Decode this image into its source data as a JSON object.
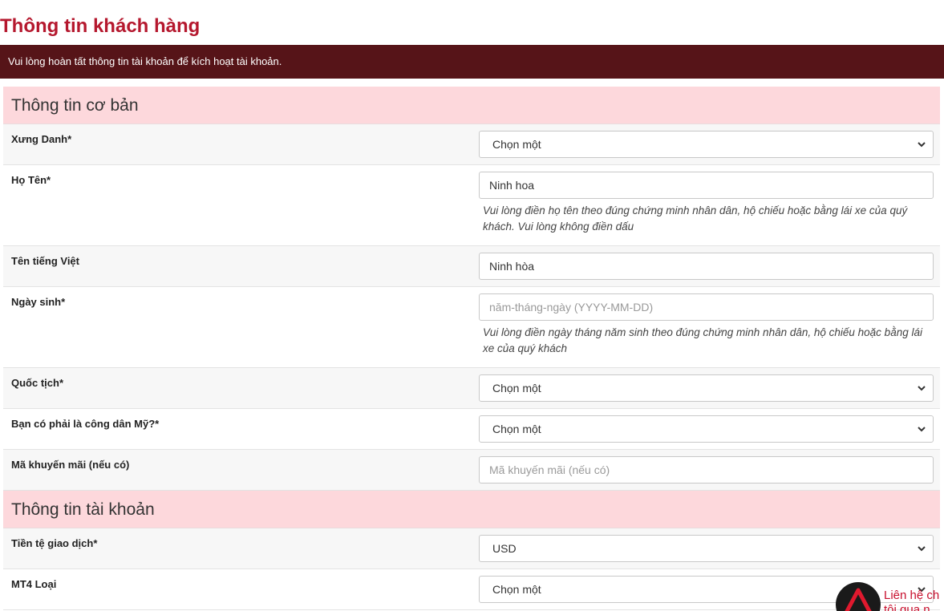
{
  "page": {
    "title": "Thông tin khách hàng",
    "notice": "Vui lòng hoàn tất thông tin tài khoản để kích hoạt tài khoản."
  },
  "sections": {
    "basic": {
      "title": "Thông tin cơ bản",
      "salutation": {
        "label": "Xưng Danh*",
        "value": "Chọn một"
      },
      "full_name": {
        "label": "Họ Tên*",
        "value": "Ninh hoa",
        "help": "Vui lòng điền họ tên theo đúng chứng minh nhân dân, hộ chiếu hoặc bằng lái xe của quý khách. Vui lòng không điền dấu"
      },
      "vietnamese_name": {
        "label": "Tên tiếng Việt",
        "value": "Ninh hòa"
      },
      "birth_date": {
        "label": "Ngày sinh*",
        "placeholder": "năm-tháng-ngày (YYYY-MM-DD)",
        "help": "Vui lòng điền ngày tháng năm sinh theo đúng chứng minh nhân dân, hộ chiếu hoặc bằng lái xe của quý khách"
      },
      "nationality": {
        "label": "Quốc tịch*",
        "value": "Chọn một"
      },
      "us_citizen": {
        "label": "Bạn có phải là công dân Mỹ?*",
        "value": "Chọn một"
      },
      "promo_code": {
        "label": "Mã khuyến mãi (nếu có)",
        "placeholder": "Mã khuyến mãi (nếu có)"
      }
    },
    "account": {
      "title": "Thông tin tài khoản",
      "currency": {
        "label": "Tiền tệ giao dịch*",
        "value": "USD"
      },
      "mt4_type": {
        "label": "MT4 Loại",
        "value": "Chọn một"
      }
    }
  },
  "contact_widget": {
    "line1": "Liên hệ ch",
    "line2": "tôi qua n"
  },
  "colors": {
    "title": "#b5182e",
    "notice_bg": "#561418",
    "section_bg": "#fdd8dc",
    "contact_text": "#c8102e"
  },
  "icons": {
    "select_arrow": "chevron-down-icon",
    "contact_logo": "contact-logo-icon"
  }
}
